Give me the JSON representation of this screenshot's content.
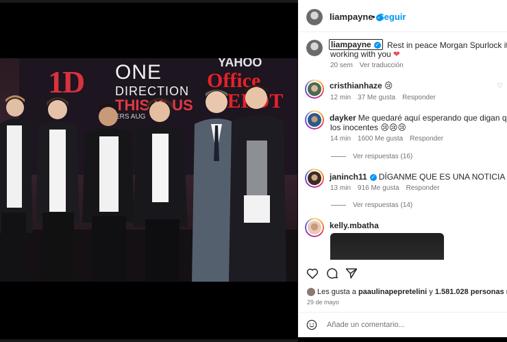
{
  "post": {
    "banner": {
      "logo": "1D",
      "line1": "ONE",
      "line2": "DIRECTION",
      "line3": "THIS IS US",
      "line4": "ERS AUG",
      "sponsor1": "YAHOO",
      "sponsor2": "Office",
      "sponsor3": "DEPOT"
    }
  },
  "header": {
    "username": "liampayne",
    "verified_mark": "✓",
    "dot": "•",
    "follow_label": "Seguir"
  },
  "caption": {
    "username": "liampayne",
    "text_line1": "Rest in peace Morgan Spurlock it was a pleas",
    "text_line2": "working with you",
    "heart": "❤",
    "time": "20 sem",
    "translate_label": "Ver traducción"
  },
  "comments": [
    {
      "username": "cristhianhaze",
      "text": "😢",
      "time": "12 min",
      "likes": "37 Me gusta",
      "reply_label": "Responder"
    },
    {
      "username": "dayker",
      "text": "Me quedaré aquí esperando que digan que es el d",
      "text_line2": "los inocentes 😢😢😢",
      "time": "14 min",
      "likes": "1600 Me gusta",
      "reply_label": "Responder",
      "view_replies": "Ver respuestas (16)"
    },
    {
      "username": "janinch11",
      "verified_mark": "✓",
      "text": "DÍGANME QUE ES UNA NOTICIA FALSA 😭😭",
      "time": "13 min",
      "likes": "916 Me gusta",
      "reply_label": "Responder",
      "view_replies": "Ver respuestas (14)"
    },
    {
      "username": "kelly.mbatha"
    }
  ],
  "footer": {
    "likes_prefix": "Les gusta a",
    "liker": "paaulinapepretelini",
    "likes_mid": "y",
    "likes_count": "1.581.028 personas más",
    "date": "29 de mayo",
    "comment_placeholder": "Añade un comentario..."
  },
  "colors": {
    "link": "#0095f6",
    "heart": "#ed4956",
    "muted": "#737373"
  },
  "icons": [
    "heart-icon",
    "comment-icon",
    "share-icon",
    "emoji-icon",
    "like-small-icon"
  ]
}
